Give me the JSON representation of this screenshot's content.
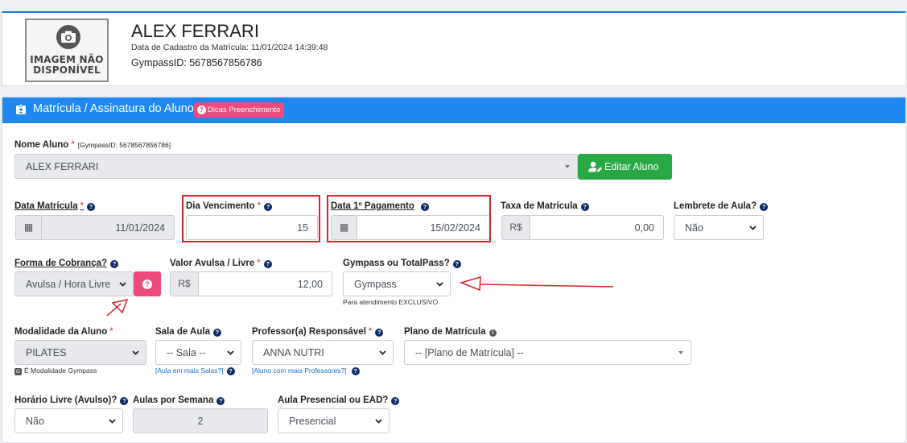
{
  "student": {
    "photo_caption_1": "IMAGEM NÃO",
    "photo_caption_2": "DISPONÍVEL",
    "name": "ALEX FERRARI",
    "registration": "Data de Cadastro da Matrícula: 11/01/2024 14:39:48",
    "gympass_id": "GympassID: 5678567856786"
  },
  "form": {
    "title": "Matrícula / Assinatura do Aluno",
    "tips_badge": "Dicas Preenchimento",
    "student_name": {
      "label": "Nome Aluno",
      "note": "[GympassID: 5678567856786]",
      "value": "ALEX FERRARI",
      "edit_button": "Editar Aluno"
    },
    "enrollment_date": {
      "label": "Data Matrícula",
      "value": "11/01/2024"
    },
    "due_day": {
      "label": "Dia Vencimento",
      "value": "15"
    },
    "first_payment": {
      "label": "Data 1º Pagamento",
      "value": "15/02/2024"
    },
    "enrollment_fee": {
      "label": "Taxa de Matrícula",
      "prefix": "R$",
      "value": "0,00"
    },
    "class_reminder": {
      "label": "Lembrete de Aula?",
      "value": "Não"
    },
    "billing_method": {
      "label": "Forma de Cobrança?",
      "value": "Avulsa / Hora Livre"
    },
    "single_value": {
      "label": "Valor Avulsa / Livre",
      "prefix": "R$",
      "value": "12,00"
    },
    "gympass_totalpass": {
      "label": "Gympass ou TotalPass?",
      "value": "Gympass",
      "hint": "Para atendimento EXCLUSIVO"
    },
    "modality": {
      "label": "Modalidade da Aluno",
      "value": "PILATES",
      "hint": "É Modalidade Gympass"
    },
    "classroom": {
      "label": "Sala de Aula",
      "value": "-- Sala --",
      "link": "[Aula em mais Salas?]"
    },
    "teacher": {
      "label": "Professor(a) Responsável",
      "value": "ANNA NUTRI",
      "link": "[Aluno com mais Professores?]"
    },
    "plan": {
      "label": "Plano de Matrícula",
      "value": "-- [Plano de Matrícula] --"
    },
    "free_hours": {
      "label": "Horário Livre (Avulso)?",
      "value": "Não"
    },
    "classes_per_week": {
      "label": "Aulas por Semana",
      "value": "2"
    },
    "presence_mode": {
      "label": "Aula Presencial ou EAD?",
      "value": "Presencial"
    }
  },
  "colors": {
    "header_blue": "#1e88f0",
    "edit_green": "#28a745",
    "help_pink": "#ef4a7c",
    "annotation_red": "#d6242c"
  }
}
